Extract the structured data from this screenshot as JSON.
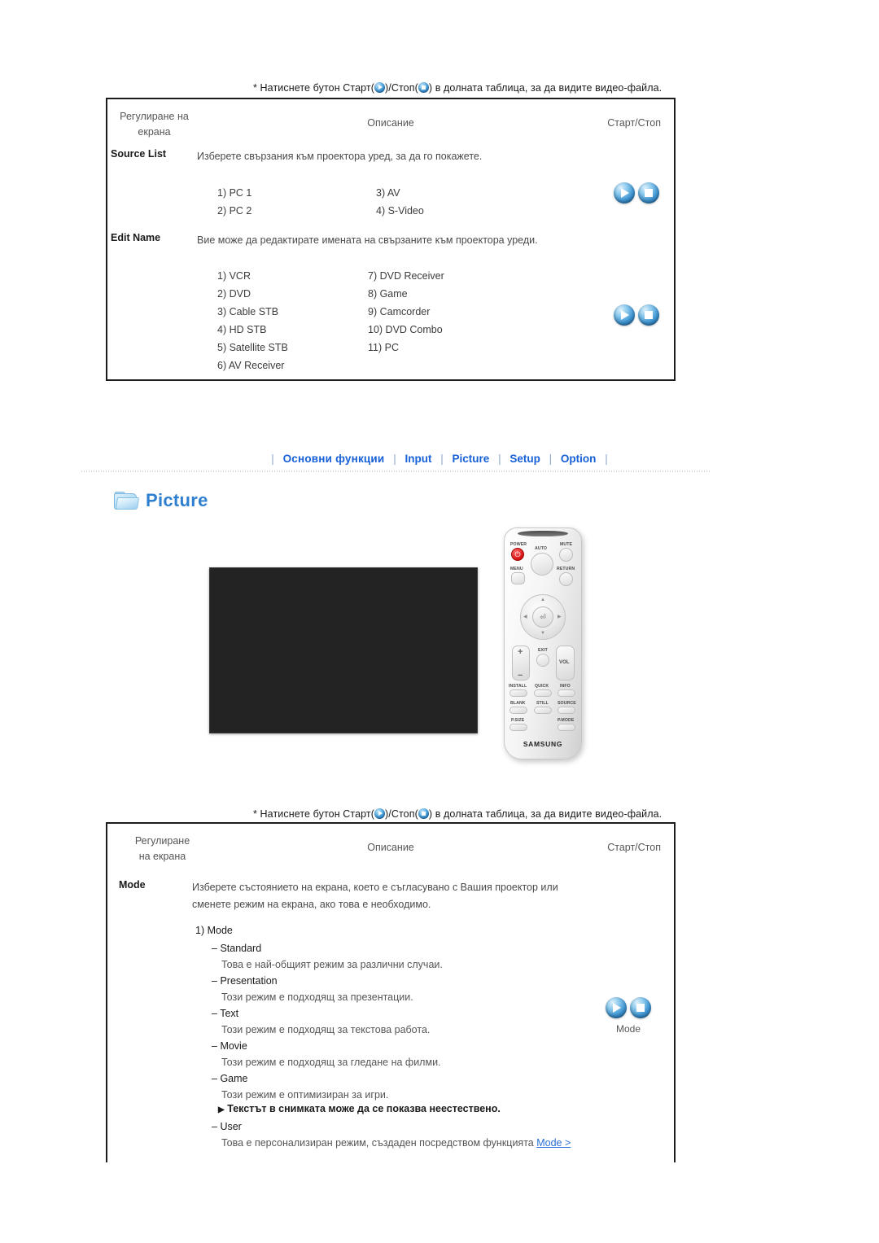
{
  "page": {
    "note_line": {
      "before": "* Натиснете бутон Старт(",
      "middle": ")/Стоп(",
      "after": ") в долната таблица, за да видите видео-файла."
    }
  },
  "table_top": {
    "headers": {
      "col1_line1": "Регулиране на",
      "col1_line2": "екрана",
      "col2": "Описание",
      "col3": "Старт/Стоп"
    },
    "rows": [
      {
        "name": "Source List",
        "description": "Изберете свързания към проектора уред, за да го покажете.",
        "items_left": [
          "1) PC 1",
          "2) PC 2"
        ],
        "items_right": [
          "3) AV",
          "4) S-Video"
        ]
      },
      {
        "name": "Edit Name",
        "description": "Вие може да редактирате имената на свързаните към проектора уреди.",
        "items_left": [
          "1) VCR",
          "2) DVD",
          "3) Cable STB",
          "4) HD STB",
          "5) Satellite STB",
          "6) AV Receiver"
        ],
        "items_right": [
          "7) DVD Receiver",
          "8) Game",
          "9) Camcorder",
          "10) DVD Combo",
          "11) PC"
        ]
      }
    ]
  },
  "navbar": {
    "items": [
      {
        "label": "Основни функции"
      },
      {
        "label": "Input"
      },
      {
        "label": "Picture"
      },
      {
        "label": "Setup"
      },
      {
        "label": "Option"
      }
    ],
    "separator": "|",
    "accent_color": "#1660d8"
  },
  "section": {
    "icon": "folder-icon",
    "title": "Picture"
  },
  "remote": {
    "brand": "SAMSUNG",
    "buttons": [
      "POWER",
      "AUTO",
      "MUTE",
      "MENU",
      "RETURN",
      "EXIT",
      "VOL",
      "INSTALL",
      "QUICK",
      "INFO",
      "BLANK",
      "STILL",
      "SOURCE",
      "P.SIZE",
      "P.MODE"
    ]
  },
  "table_bottom": {
    "headers": {
      "col1_line1": "Регулиране",
      "col1_line2": "на екрана",
      "col2": "Описание",
      "col3": "Старт/Стоп"
    },
    "row": {
      "name": "Mode",
      "description_line1": "Изберете състоянието на екрана, което е съгласувано с Вашия проектор или",
      "description_line2": "сменете режим на екрана, ако това е необходимо.",
      "numbered_item": "1) Mode",
      "modes": [
        {
          "dash": "–",
          "name": "Standard",
          "desc": "Това е най-общият режим за различни случаи."
        },
        {
          "dash": "–",
          "name": "Presentation",
          "desc": "Този режим е подходящ за презентации."
        },
        {
          "dash": "–",
          "name": "Text",
          "desc": "Този режим е подходящ за текстова работа."
        },
        {
          "dash": "–",
          "name": "Movie",
          "desc": "Този режим е подходящ за гледане на филми."
        },
        {
          "dash": "–",
          "name": "Game",
          "desc": "Този режим е оптимизиран за игри.",
          "note": "Текстът в снимката може да се показва неестествено."
        },
        {
          "dash": "–",
          "name": "User",
          "desc_prefix": "Това е персонализиран режим, създаден посредством функцията ",
          "desc_link": "Mode >"
        }
      ],
      "startstop_label": "Mode"
    }
  }
}
